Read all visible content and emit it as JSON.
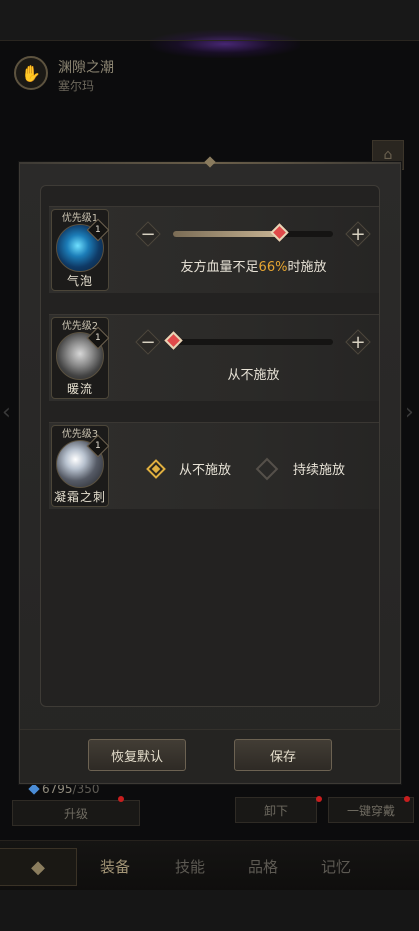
{
  "background": {
    "title": "渊隙之潮",
    "subtitle": "塞尔玛",
    "exp": {
      "current": "6795",
      "max": "/350"
    },
    "buttons": {
      "upgrade": "升级",
      "unequip": "卸下",
      "one_click": "一键穿戴"
    },
    "tabs": [
      "装备",
      "技能",
      "品格",
      "记忆"
    ],
    "active_tab": "装备"
  },
  "modal": {
    "rows": [
      {
        "priority": "优先级1",
        "skill": "气泡",
        "level": "1",
        "control": "slider",
        "minus_icon": "minus-icon",
        "plus_icon": "plus-icon",
        "value": 0.66,
        "caption_before": "友方血量不足",
        "caption_pct": "66%",
        "caption_after": "时施放"
      },
      {
        "priority": "优先级2",
        "skill": "暖流",
        "level": "1",
        "control": "slider",
        "value": 0,
        "caption": "从不施放"
      },
      {
        "priority": "优先级3",
        "skill": "凝霜之刺",
        "level": "1",
        "control": "options",
        "options": [
          {
            "label": "从不施放",
            "checked": true
          },
          {
            "label": "持续施放",
            "checked": false
          }
        ]
      }
    ],
    "buttons": {
      "reset": "恢复默认",
      "save": "保存"
    }
  },
  "colors": {
    "accent": "#e6a532",
    "thumb": "#e04a4a",
    "checkbox": "#e0b040"
  }
}
